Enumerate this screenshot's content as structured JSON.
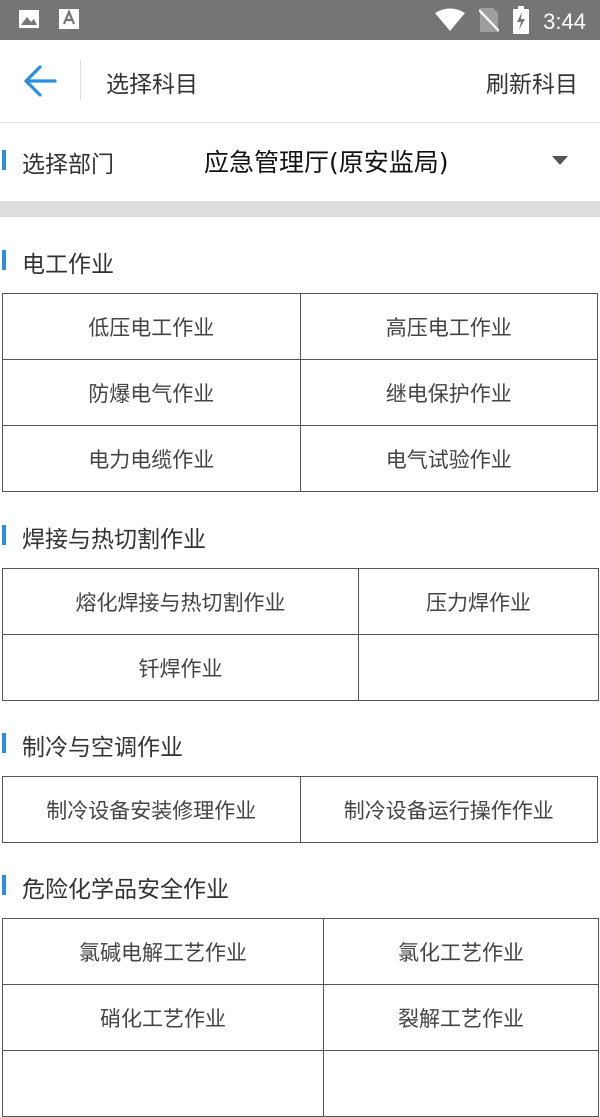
{
  "status_bar": {
    "time": "3:44",
    "icons": [
      "image-icon",
      "font-icon",
      "wifi-icon",
      "no-sim-icon",
      "battery-charging-icon"
    ]
  },
  "header": {
    "title": "选择科目",
    "refresh": "刷新科目",
    "back_icon": "arrow-left-icon",
    "accent": "#2b8fe0"
  },
  "department": {
    "label": "选择部门",
    "value": "应急管理厅(原安监局)"
  },
  "sections": [
    {
      "title": "电工作业",
      "items": [
        "低压电工作业",
        "高压电工作业",
        "防爆电气作业",
        "继电保护作业",
        "电力电缆作业",
        "电气试验作业"
      ]
    },
    {
      "title": "焊接与热切割作业",
      "items": [
        "熔化焊接与热切割作业",
        "压力焊作业",
        "钎焊作业",
        ""
      ]
    },
    {
      "title": "制冷与空调作业",
      "items": [
        "制冷设备安装修理作业",
        "制冷设备运行操作作业"
      ]
    },
    {
      "title": "危险化学品安全作业",
      "items": [
        "氯碱电解工艺作业",
        "氯化工艺作业",
        "硝化工艺作业",
        "裂解工艺作业"
      ]
    }
  ]
}
